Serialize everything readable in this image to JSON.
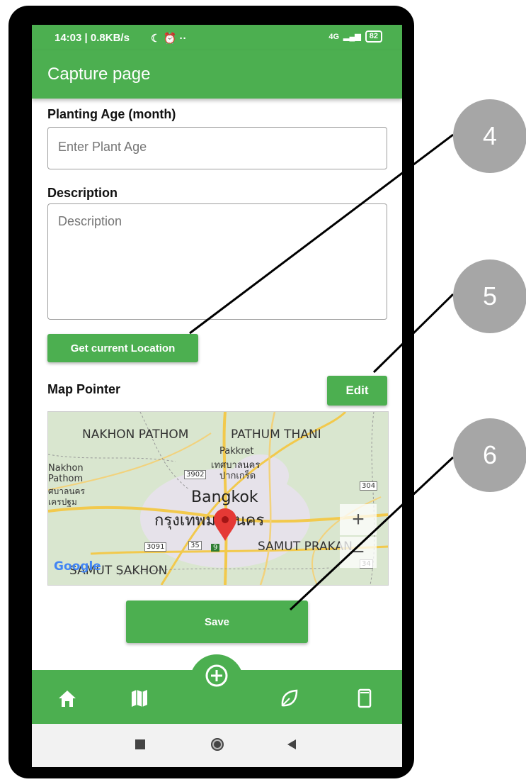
{
  "status_bar": {
    "time": "14:03 | 0.8KB/s",
    "network": "4G",
    "battery": "82"
  },
  "app_bar": {
    "title": "Capture page"
  },
  "form": {
    "planting_age_label": "Planting Age (month)",
    "planting_age_placeholder": "Enter Plant Age",
    "description_label": "Description",
    "description_placeholder": "Description",
    "get_location_button": "Get current Location",
    "map_pointer_label": "Map Pointer",
    "edit_button": "Edit",
    "save_button": "Save"
  },
  "map": {
    "labels": {
      "nakhon_pathom": "NAKHON PATHOM",
      "pathum_thani": "PATHUM THANI",
      "pakkret": "Pakkret",
      "pakkret_thai1": "เทศบาลนคร",
      "pakkret_thai2": "ปากเกร็ด",
      "nakhon_left": "Nakhon",
      "pathom_left": "Pathom",
      "left_thai1": "ศบาลนคร",
      "left_thai2": "เครปฐม",
      "bangkok": "Bangkok",
      "bangkok_thai": "กรุงเทพมหานคร",
      "samut_prakan": "SAMUT PRAKAN",
      "samut_sakhon": "SAMUT SAKHON",
      "google": "Google"
    },
    "road_shields": [
      "3902",
      "304",
      "3091",
      "35",
      "9",
      "34"
    ],
    "zoom_in": "+",
    "zoom_out": "−"
  },
  "bottom_nav": {
    "items": [
      {
        "icon": "home-icon"
      },
      {
        "icon": "map-icon"
      },
      {
        "icon": "add-circle-icon"
      },
      {
        "icon": "leaf-icon"
      },
      {
        "icon": "phone-icon"
      }
    ]
  },
  "system_nav": {
    "icons": [
      "square-icon",
      "circle-icon",
      "back-triangle-icon"
    ]
  },
  "callouts": [
    "4",
    "5",
    "6"
  ],
  "colors": {
    "primary": "#4caf50",
    "callout": "#a6a6a6",
    "pin": "#e53935"
  }
}
